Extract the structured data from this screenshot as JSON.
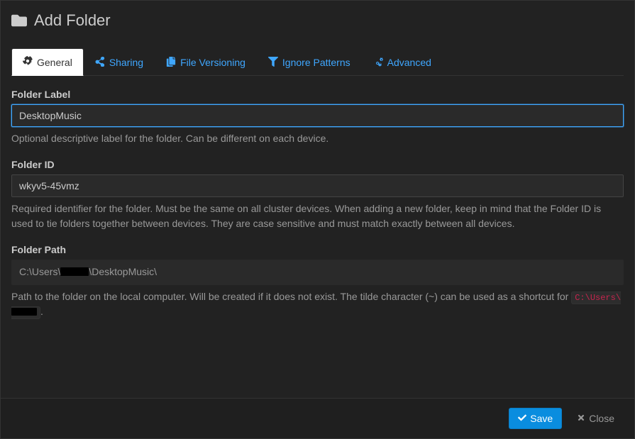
{
  "header": {
    "title": "Add Folder"
  },
  "tabs": {
    "general": "General",
    "sharing": "Sharing",
    "file_versioning": "File Versioning",
    "ignore_patterns": "Ignore Patterns",
    "advanced": "Advanced"
  },
  "form": {
    "folder_label": {
      "label": "Folder Label",
      "value": "DesktopMusic",
      "help": "Optional descriptive label for the folder. Can be different on each device."
    },
    "folder_id": {
      "label": "Folder ID",
      "value": "wkyv5-45vmz",
      "help": "Required identifier for the folder. Must be the same on all cluster devices. When adding a new folder, keep in mind that the Folder ID is used to tie folders together between devices. They are case sensitive and must match exactly between all devices."
    },
    "folder_path": {
      "label": "Folder Path",
      "value_prefix": "C:\\Users\\",
      "value_suffix": "\\DesktopMusic\\",
      "help_prefix": "Path to the folder on the local computer. Will be created if it does not exist. The tilde character (~) can be used as a shortcut for ",
      "help_code_prefix": "C:\\Users\\",
      "help_suffix": "."
    }
  },
  "footer": {
    "save": "Save",
    "close": "Close"
  }
}
